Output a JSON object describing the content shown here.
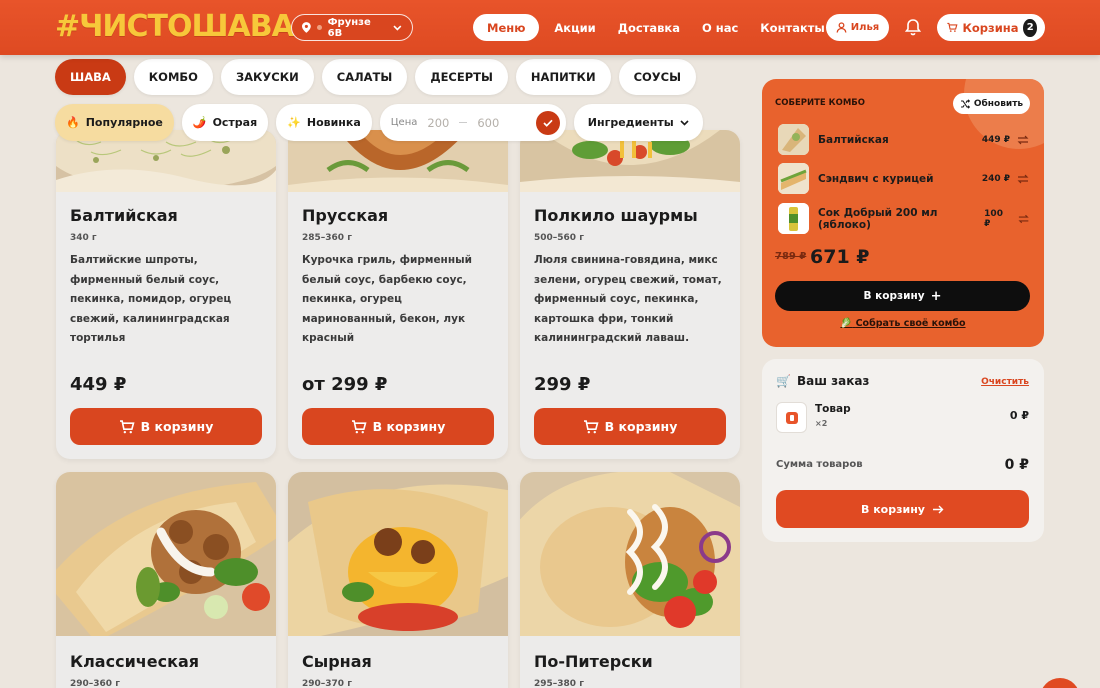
{
  "header": {
    "logo": "#ЧИСТОШАВА",
    "location": "Фрунзе 6В",
    "nav": [
      "Меню",
      "Акции",
      "Доставка",
      "О нас",
      "Контакты"
    ],
    "user": "Илья",
    "cart_label": "Корзина",
    "cart_count": "2"
  },
  "categories": [
    "ШАВА",
    "КОМБО",
    "ЗАКУСКИ",
    "САЛАТЫ",
    "ДЕСЕРТЫ",
    "НАПИТКИ",
    "СОУСЫ"
  ],
  "filters": {
    "popular": "Популярное",
    "spicy": "Острая",
    "new": "Новинка",
    "price_label": "Цена",
    "price_from": "200",
    "price_to": "600",
    "ingredients": "Ингредиенты"
  },
  "products": [
    {
      "name": "Балтийская",
      "weight": "340 г",
      "desc": "Балтийские шпроты, фирменный белый соус, пекинка, помидор, огурец свежий, калининградская тортилья",
      "price": "449 ₽",
      "button": "В корзину"
    },
    {
      "name": "Прусская",
      "weight": "285–360 г",
      "desc": "Курочка гриль, фирменный белый соус, барбекю соус, пекинка, огурец маринованный, бекон, лук красный",
      "price": "от 299 ₽",
      "button": "В корзину"
    },
    {
      "name": "Полкило шаурмы",
      "weight": "500–560 г",
      "desc": "Люля свинина-говядина, микс зелени, огурец свежий, томат, фирменный соус, пекинка, картошка фри, тонкий калининградский лаваш.",
      "price": "299 ₽",
      "button": "В корзину"
    },
    {
      "name": "Классическая",
      "weight": "290–360 г"
    },
    {
      "name": "Сырная",
      "weight": "290–370 г"
    },
    {
      "name": "По-Питерски",
      "weight": "295–380 г"
    }
  ],
  "combo": {
    "title": "СОБЕРИТЕ КОМБО",
    "refresh": "Обновить",
    "items": [
      {
        "name": "Балтийская",
        "price": "449 ₽"
      },
      {
        "name": "Сэндвич с курицей",
        "price": "240 ₽"
      },
      {
        "name": "Сок Добрый 200 мл (яблоко)",
        "price": "100 ₽"
      }
    ],
    "old_price": "789 ₽",
    "new_price": "671 ₽",
    "cart_button": "В корзину",
    "link": "Собрать своё комбо"
  },
  "order": {
    "title": "Ваш заказ",
    "clear": "Очистить",
    "item_name": "Товар",
    "item_qty": "×2",
    "item_price": "0 ₽",
    "sum_label": "Сумма товаров",
    "sum_value": "0 ₽",
    "button": "В корзину"
  }
}
